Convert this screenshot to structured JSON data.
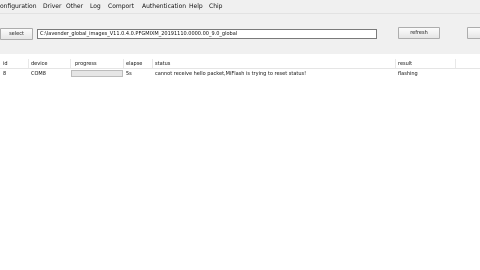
{
  "menu": [
    "onfiguration",
    "Driver",
    "Other",
    "Log",
    "Comport",
    "Authentication",
    "Help",
    "Chip"
  ],
  "toolbar": {
    "select_label": "select",
    "path_value": "C:\\lavender_global_images_V11.0.4.0.PFGMIXM_20191110.0000.00_9.0_global",
    "refresh_label": "refresh",
    "right_button_label": ""
  },
  "table": {
    "columns": [
      "id",
      "device",
      "progress",
      "elapse",
      "status",
      "result"
    ],
    "rows": [
      {
        "id": "8",
        "device": "COM8",
        "progress": 0,
        "elapse": "5s",
        "status": "cannot receive hello packet,MiFlash is trying to reset status!",
        "result": "flashing"
      }
    ]
  }
}
